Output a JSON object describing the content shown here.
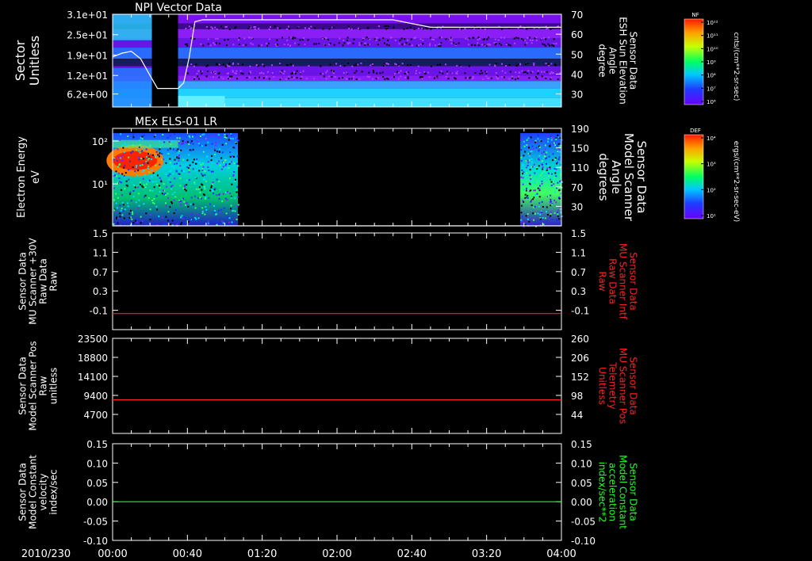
{
  "time_axis": {
    "date_label": "2010/230",
    "ticks": [
      "00:00",
      "00:40",
      "01:20",
      "02:00",
      "02:40",
      "03:20",
      "04:00"
    ],
    "range_minutes": [
      0,
      240
    ]
  },
  "colors": {
    "background": "#000000",
    "foreground": "#ffffff",
    "red_axis": "#ff2020",
    "green_axis": "#22ff22"
  },
  "colorbars": [
    {
      "tag": "NF",
      "title": "cnts/(cm**2-sr-sec)",
      "ticks": [
        "10¹²",
        "10¹¹",
        "10¹⁰",
        "10⁹",
        "10⁸",
        "10⁷",
        "10⁶"
      ]
    },
    {
      "tag": "DEF",
      "title": "ergs/(cm**2-sr-sec-eV)",
      "ticks": [
        "10⁴",
        "10³",
        "10²",
        "10¹"
      ]
    }
  ],
  "chart_data": [
    {
      "type": "heatmap",
      "title": "NPI Vector Data",
      "ylabel": [
        "Sector",
        "Unitless"
      ],
      "yticks": [
        "3.1e+01",
        "2.5e+01",
        "1.9e+01",
        "1.2e+01",
        "6.2e+00"
      ],
      "y2label": [
        "Sensor Data",
        "ESH Sun Elevation",
        "Angle",
        "degree"
      ],
      "y2ticks": [
        "70",
        "60",
        "50",
        "40",
        "30"
      ],
      "y2lim": [
        20,
        70
      ],
      "overlay_line": {
        "name": "ESH Sun Elevation Angle",
        "x": [
          0,
          5,
          10,
          15,
          20,
          24,
          28,
          30,
          35,
          38,
          41,
          44,
          48,
          90,
          150,
          170,
          240
        ],
        "y": [
          47,
          49,
          50,
          46,
          37,
          30,
          30,
          30,
          30,
          33,
          47,
          66,
          67,
          67,
          67,
          63,
          63
        ]
      }
    },
    {
      "type": "heatmap",
      "title": "MEx ELS-01 LR",
      "ylabel": [
        "Electron Energy",
        "eV"
      ],
      "yticks": [
        "10²",
        "10¹"
      ],
      "ylog": true,
      "y2label": [
        "Sensor Data",
        "Model Scanner",
        "Angle",
        "degrees"
      ],
      "y2ticks": [
        "190",
        "150",
        "110",
        "70",
        "30"
      ],
      "y2lim": [
        5,
        190
      ],
      "overlay_line": {
        "name": "Model Scanner Angle",
        "x": [
          0,
          240
        ],
        "y": [
          5,
          5
        ]
      },
      "data_coverage_minutes": [
        [
          0,
          67
        ],
        [
          218,
          240
        ]
      ]
    },
    {
      "type": "line",
      "ylabel": [
        "Sensor Data",
        "MU Scanner +30V",
        "Raw Data",
        "Raw"
      ],
      "yticks": [
        "1.5",
        "1.1",
        "0.7",
        "0.3",
        "-0.1"
      ],
      "ylim": [
        -0.3,
        1.5
      ],
      "y2label": [
        "Sensor Data",
        "MU Scanner Intf",
        "Raw Data",
        "Raw"
      ],
      "y2ticks": [
        "1.5",
        "1.1",
        "0.7",
        "0.3",
        "-0.1"
      ],
      "series": [
        {
          "x": [
            0,
            240
          ],
          "y": [
            0.0,
            0.0
          ]
        }
      ]
    },
    {
      "type": "line",
      "ylabel": [
        "Sensor Data",
        "Model Scanner Pos",
        "Raw",
        "unitless"
      ],
      "yticks": [
        "23500",
        "18800",
        "14100",
        "9400",
        "4700"
      ],
      "ylim": [
        0,
        23500
      ],
      "y2label": [
        "Sensor Data",
        "MU Scanner Pos",
        "Telemetry",
        "Unitless"
      ],
      "y2ticks": [
        "260",
        "206",
        "152",
        "98",
        "44"
      ],
      "series": [
        {
          "x": [
            0,
            240
          ],
          "y": [
            8300,
            8300
          ]
        }
      ]
    },
    {
      "type": "line",
      "ylabel": [
        "Sensor Data",
        "Model Constant",
        "velocity",
        "index/sec"
      ],
      "yticks": [
        "0.15",
        "0.10",
        "0.05",
        "0.00",
        "-0.05",
        "-0.10"
      ],
      "ylim": [
        -0.1,
        0.15
      ],
      "y2label": [
        "Sensor Data",
        "Model Constant",
        "acceleration",
        "index/sec**2"
      ],
      "y2ticks": [
        "0.15",
        "0.10",
        "0.05",
        "0.00",
        "-0.05",
        "-0.10"
      ],
      "series": [
        {
          "x": [
            0,
            240
          ],
          "y": [
            0.0,
            0.0
          ]
        }
      ]
    }
  ]
}
